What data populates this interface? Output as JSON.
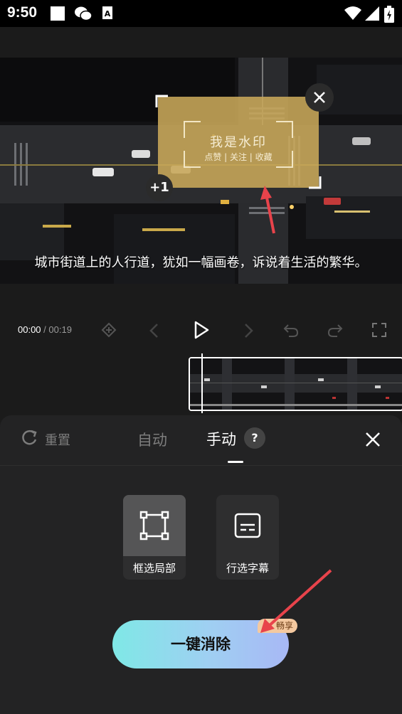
{
  "status_bar": {
    "time": "9:50",
    "icons": [
      "blank-notification-icon",
      "wechat-icon",
      "text-a-icon",
      "wifi-icon",
      "signal-icon",
      "battery-charging-icon"
    ]
  },
  "preview": {
    "subtitle": "城市街道上的人行道，犹如一幅画卷，诉说着生活的繁华。",
    "watermark_title": "我是水印",
    "watermark_sub": "点赞 | 关注 | 收藏",
    "add_count": "+1"
  },
  "player": {
    "current_time": "00:00",
    "separator": " / ",
    "total_time": "00:19"
  },
  "panel": {
    "reset_label": "重置",
    "tab_auto": "自动",
    "tab_manual": "手动",
    "help": "?",
    "tools": [
      {
        "label": "框选局部",
        "icon": "box-select-icon",
        "active": true
      },
      {
        "label": "行选字幕",
        "icon": "subtitle-select-icon",
        "active": false
      }
    ],
    "erase_button": "一键消除",
    "vip_badge": "畅享"
  },
  "colors": {
    "watermark": "#caa85a",
    "annotation_arrow": "#e8434b",
    "erase_gradient_start": "#7fe8e6",
    "erase_gradient_end": "#a8b8f5",
    "vip_badge": "#f4c9a0"
  }
}
